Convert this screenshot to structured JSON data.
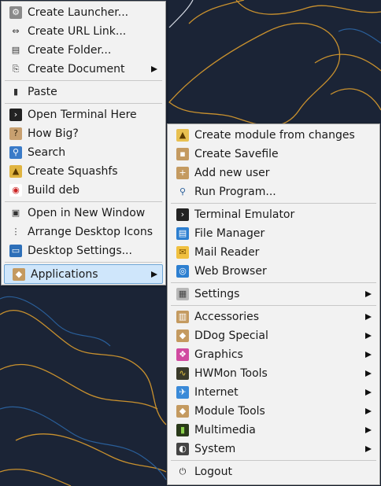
{
  "context_menu": {
    "groups": [
      [
        {
          "label": "Create Launcher...",
          "icon": "launcher-icon",
          "submenu": false
        },
        {
          "label": "Create URL Link...",
          "icon": "link-icon",
          "submenu": false
        },
        {
          "label": "Create Folder...",
          "icon": "folder-icon",
          "submenu": false
        },
        {
          "label": "Create Document",
          "icon": "document-icon",
          "submenu": true
        }
      ],
      [
        {
          "label": "Paste",
          "icon": "paste-icon",
          "submenu": false
        }
      ],
      [
        {
          "label": "Open Terminal Here",
          "icon": "terminal-icon",
          "submenu": false
        },
        {
          "label": "How Big?",
          "icon": "size-icon",
          "submenu": false
        },
        {
          "label": "Search",
          "icon": "search-icon",
          "submenu": false
        },
        {
          "label": "Create Squashfs",
          "icon": "squashfs-icon",
          "submenu": false
        },
        {
          "label": "Build deb",
          "icon": "deb-icon",
          "submenu": false
        }
      ],
      [
        {
          "label": "Open in New Window",
          "icon": "window-icon",
          "submenu": false
        },
        {
          "label": "Arrange Desktop Icons",
          "icon": "arrange-icon",
          "submenu": false
        },
        {
          "label": "Desktop Settings...",
          "icon": "desktop-icon",
          "submenu": false
        }
      ],
      [
        {
          "label": "Applications",
          "icon": "applications-icon",
          "submenu": true,
          "highlighted": true
        }
      ]
    ]
  },
  "applications_menu": {
    "groups": [
      [
        {
          "label": "Create module from changes",
          "icon": "module-icon",
          "submenu": false
        },
        {
          "label": "Create Savefile",
          "icon": "savefile-icon",
          "submenu": false
        },
        {
          "label": "Add new user",
          "icon": "add-user-icon",
          "submenu": false
        },
        {
          "label": "Run Program...",
          "icon": "run-icon",
          "submenu": false
        }
      ],
      [
        {
          "label": "Terminal Emulator",
          "icon": "terminal-icon",
          "submenu": false
        },
        {
          "label": "File Manager",
          "icon": "file-manager-icon",
          "submenu": false
        },
        {
          "label": "Mail Reader",
          "icon": "mail-icon",
          "submenu": false
        },
        {
          "label": "Web Browser",
          "icon": "web-browser-icon",
          "submenu": false
        }
      ],
      [
        {
          "label": "Settings",
          "icon": "settings-icon",
          "submenu": true
        }
      ],
      [
        {
          "label": "Accessories",
          "icon": "accessories-icon",
          "submenu": true
        },
        {
          "label": "DDog Special",
          "icon": "ddog-icon",
          "submenu": true
        },
        {
          "label": "Graphics",
          "icon": "graphics-icon",
          "submenu": true
        },
        {
          "label": "HWMon Tools",
          "icon": "hwmon-icon",
          "submenu": true
        },
        {
          "label": "Internet",
          "icon": "internet-icon",
          "submenu": true
        },
        {
          "label": "Module Tools",
          "icon": "module-tools-icon",
          "submenu": true
        },
        {
          "label": "Multimedia",
          "icon": "multimedia-icon",
          "submenu": true
        },
        {
          "label": "System",
          "icon": "system-icon",
          "submenu": true
        }
      ],
      [
        {
          "label": "Logout",
          "icon": "logout-icon",
          "submenu": false
        }
      ]
    ]
  },
  "colors": {
    "wallpaper": "#1b2436",
    "contour_gold": "#c9912e",
    "contour_blue": "#2a5f9a",
    "highlight": "#cfe6fb"
  }
}
